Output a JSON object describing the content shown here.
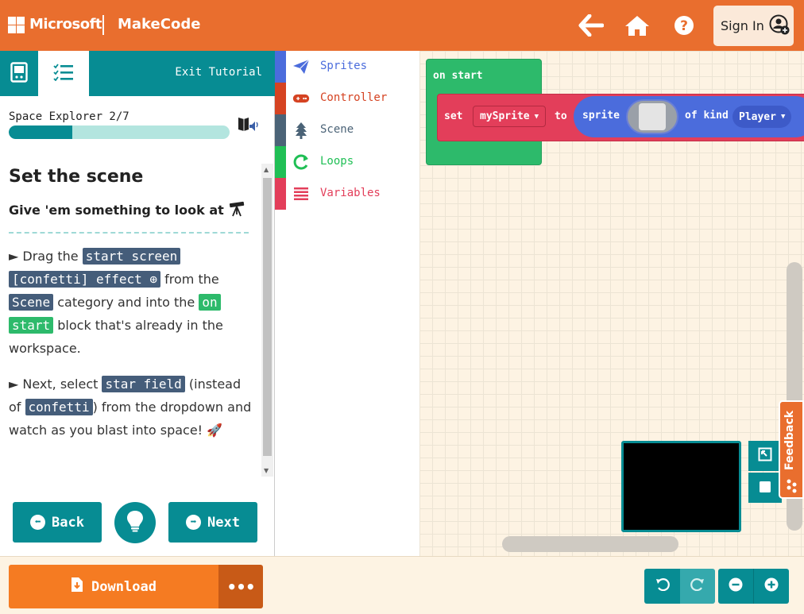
{
  "header": {
    "brand": "Microsoft",
    "product": "MakeCode",
    "sign_in": "Sign In"
  },
  "tutorial": {
    "exit": "Exit Tutorial",
    "step_label": "Space Explorer 2/7",
    "progress_fraction": 0.286,
    "title": "Set the scene",
    "subtitle": "Give 'em something to look at",
    "para1": {
      "bullet": "►",
      "t1": " Drag the ",
      "c1": "start screen",
      "c2": "[confetti] effect ⊕",
      "t2": " from the ",
      "c3": "Scene",
      "t3": " category and into the ",
      "c4": "on",
      "c5": "start",
      "t4": " block that's already in the workspace."
    },
    "para2": {
      "bullet": "►",
      "t1": " Next, select ",
      "c1": "star field",
      "t2": " (instead of ",
      "c2": "confetti",
      "t3": ") from the dropdown and watch as you blast into space! 🚀"
    },
    "back": "Back",
    "next": "Next"
  },
  "toolbox": {
    "categories": [
      {
        "label": "Sprites",
        "color": "#4b6cdc",
        "icon": "paper-plane-icon"
      },
      {
        "label": "Controller",
        "color": "#d54322",
        "icon": "gamepad-icon"
      },
      {
        "label": "Scene",
        "color": "#4b6377",
        "icon": "tree-icon"
      },
      {
        "label": "Loops",
        "color": "#20bf55",
        "icon": "loop-arrow-icon"
      },
      {
        "label": "Variables",
        "color": "#e33e5a",
        "icon": "list-icon"
      }
    ]
  },
  "workspace": {
    "on_start": "on start",
    "set": "set",
    "variable": "mySprite",
    "to": "to",
    "sprite": "sprite",
    "of_kind": "of kind",
    "kind": "Player"
  },
  "feedback": "Feedback",
  "bottom": {
    "download": "Download",
    "more": "•••"
  }
}
